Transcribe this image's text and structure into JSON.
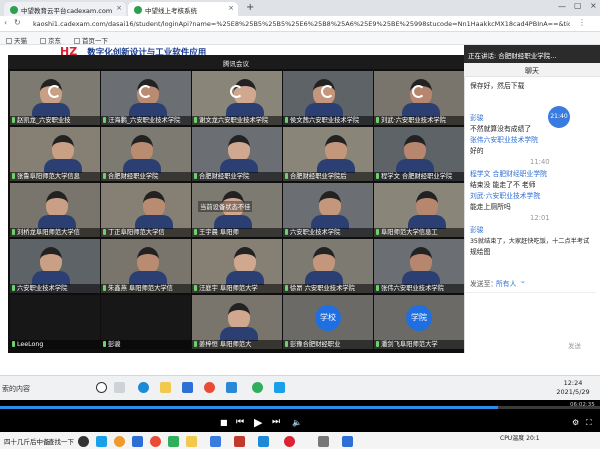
{
  "browser": {
    "tabs": [
      {
        "label": "中望教育云平台cadexam.com"
      },
      {
        "label": "中望线上考核系统"
      }
    ],
    "new_tab_symbol": "+",
    "address": "kaoshi1.cadexam.com/dasai16/student/loginApi?name=%25E8%25B5%25B5%25E6%25B8%25A6%25E9%25BE%25998stucode=Nn1HaakkcMX18cad4PBInA==&ticnum=Nn1Haakkc",
    "bookmarks": [
      "天猫",
      "京东",
      "首页一下"
    ]
  },
  "page": {
    "banner": "数字化创新设计与工业软件应用",
    "banner_logo": "HZ"
  },
  "meeting": {
    "title": "腾讯会议",
    "tiles": [
      {
        "name": "赵凯龙_六安职业技",
        "kind": "photo"
      },
      {
        "name": "汪海鹏_六安职业技术学院",
        "kind": "photo"
      },
      {
        "name": "谢文龙六安职业技术学院",
        "kind": "photo"
      },
      {
        "name": "侯文茜六安职业技术学院",
        "kind": "photo"
      },
      {
        "name": "刘武·六安职业技术学院",
        "kind": "photo"
      },
      {
        "name": "张鲁阜阳师范大学信息",
        "kind": "photo"
      },
      {
        "name": "合肥财经职业学院",
        "kind": "photo"
      },
      {
        "name": "合肥财经职业学院",
        "kind": "photo"
      },
      {
        "name": "合肥财经职业学院后",
        "kind": "photo"
      },
      {
        "name": "程学文 合肥财经职业学院",
        "kind": "photo"
      },
      {
        "name": "刘桥龙阜阳师范大学信",
        "kind": "photo"
      },
      {
        "name": "丁正阜阳师范大学信",
        "kind": "photo"
      },
      {
        "name": "王宇晨 阜阳师",
        "kind": "photo",
        "overlay": "当前设备状态不佳"
      },
      {
        "name": "六安职业技术学院",
        "kind": "photo"
      },
      {
        "name": "阜阳师范大学信息工",
        "kind": "photo"
      },
      {
        "name": "六安职业技术学院",
        "kind": "photo"
      },
      {
        "name": "朱鑫燕 阜阳师范大学信",
        "kind": "photo"
      },
      {
        "name": "汪庭宇 阜阳师范大学",
        "kind": "photo"
      },
      {
        "name": "徐昂 六安职业技术学院",
        "kind": "photo"
      },
      {
        "name": "张伟六安职业技术学院",
        "kind": "photo"
      },
      {
        "name": "LeeLong",
        "kind": "dark"
      },
      {
        "name": "彭骏",
        "kind": "dark"
      },
      {
        "name": "姜梓恒 阜阳师范大",
        "kind": "photo"
      },
      {
        "name": "彭豫合肥财经职业",
        "kind": "avatar",
        "avatar_text": "学校"
      },
      {
        "name": "潘剑飞阜阳师范大学",
        "kind": "avatar",
        "avatar_text": "学院"
      }
    ]
  },
  "chat": {
    "notice": "正在讲话: 合肥财经职业学院...",
    "header": "聊天",
    "time_badge": "21:40",
    "messages": [
      {
        "text": "保存好，然后下载",
        "style": "plain"
      },
      {
        "text": "彭骏",
        "style": "blue"
      },
      {
        "text": "不然就算没有成绩了",
        "style": "plain"
      },
      {
        "text": "张伟六安职业技术学院",
        "style": "blue"
      },
      {
        "text": "好的",
        "style": "plain"
      },
      {
        "text": "11:40",
        "style": "time"
      },
      {
        "text": "程学文 合肥财经职业学院",
        "style": "blue"
      },
      {
        "text": "结束没 能走了不 老师",
        "style": "plain"
      },
      {
        "text": "刘武·六安职业技术学院",
        "style": "blue"
      },
      {
        "text": "能走上厕所吗",
        "style": "plain"
      },
      {
        "text": "12:01",
        "style": "time"
      },
      {
        "text": "彭骏",
        "style": "blue"
      },
      {
        "text": "35就结束了，大家赶快吃饭，十二点半考试",
        "style": "plain"
      },
      {
        "text": "规绘图",
        "style": "plain"
      }
    ],
    "send_to_label": "发送至：",
    "send_to_value": "所有人",
    "send_button": "发送"
  },
  "taskbar": {
    "search_text": "索的内容",
    "clock_time": "12:24",
    "clock_date": "2021/5/29"
  },
  "player": {
    "elapsed": "06:02:35",
    "progress": 0.83,
    "start_label": "四十几斤后中备",
    "download_label": "查找一下",
    "tray_text": "CPU温度",
    "tray_time": "20:1"
  },
  "colors": {
    "accent": "#2f6fd6",
    "meeting_bg": "#0e0e0e",
    "avatar_blue": "#1f6fe0"
  }
}
